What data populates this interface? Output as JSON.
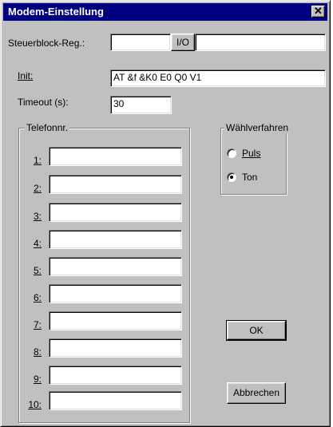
{
  "window": {
    "title": "Modem-Einstellung",
    "close_glyph": "✕"
  },
  "steuerblock": {
    "label": "Steuerblock-Reg.:",
    "value_left": "",
    "io_button": "I/O",
    "value_right": ""
  },
  "init": {
    "label": "Init:",
    "value": "AT &f &K0 E0 Q0 V1"
  },
  "timeout": {
    "label": "Timeout (s):",
    "value": "30"
  },
  "telefon": {
    "group_label": "Telefonnr.",
    "entries": [
      {
        "label": "1:",
        "value": ""
      },
      {
        "label": "2:",
        "value": ""
      },
      {
        "label": "3:",
        "value": ""
      },
      {
        "label": "4:",
        "value": ""
      },
      {
        "label": "5:",
        "value": ""
      },
      {
        "label": "6:",
        "value": ""
      },
      {
        "label": "7:",
        "value": ""
      },
      {
        "label": "8:",
        "value": ""
      },
      {
        "label": "9:",
        "value": ""
      },
      {
        "label": "10:",
        "value": ""
      }
    ]
  },
  "waehlverfahren": {
    "group_label": "Wählverfahren",
    "options": [
      {
        "label": "Puls",
        "selected": false
      },
      {
        "label": "Ton",
        "selected": true
      }
    ]
  },
  "buttons": {
    "ok": "OK",
    "cancel": "Abbrechen"
  }
}
